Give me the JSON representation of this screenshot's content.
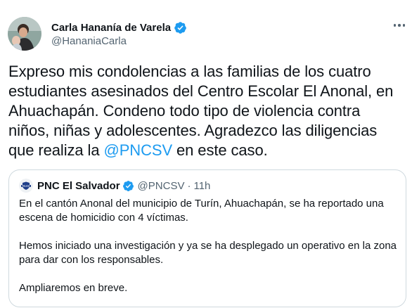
{
  "author": {
    "display_name": "Carla Hananía de Varela",
    "handle": "@HananiaCarla",
    "verified_icon": "verified-badge-icon",
    "more_icon": "more-options-icon"
  },
  "tweet": {
    "lines": [
      "Expreso mis condolencias a las familias de los cuatro",
      "estudiantes asesinados del Centro Escolar El Anonal, en",
      "Ahuachapán. Condeno todo tipo de violencia contra",
      "niños, niñas y adolescentes. Agradezco las diligencias"
    ],
    "last_line_pre": "que realiza la ",
    "mention": "@PNCSV",
    "last_line_post": " en este caso."
  },
  "quoted": {
    "display_name": "PNC El Salvador",
    "handle": "@PNCSV",
    "separator": "·",
    "time": "11h",
    "avatar_text": "POLICÍA",
    "paragraphs": [
      [
        "En el cantón Anonal del municipio de Turín, Ahuachapán, se ha reportado una",
        "escena de homicidio con 4 víctimas."
      ],
      [
        "Hemos iniciado una investigación y ya se ha desplegado un operativo en la zona",
        "para dar con los responsables."
      ],
      [
        "Ampliaremos en breve."
      ]
    ]
  },
  "colors": {
    "text": "#0f1419",
    "secondary": "#536471",
    "accent": "#1d9bf0",
    "border": "#cfd9de"
  }
}
